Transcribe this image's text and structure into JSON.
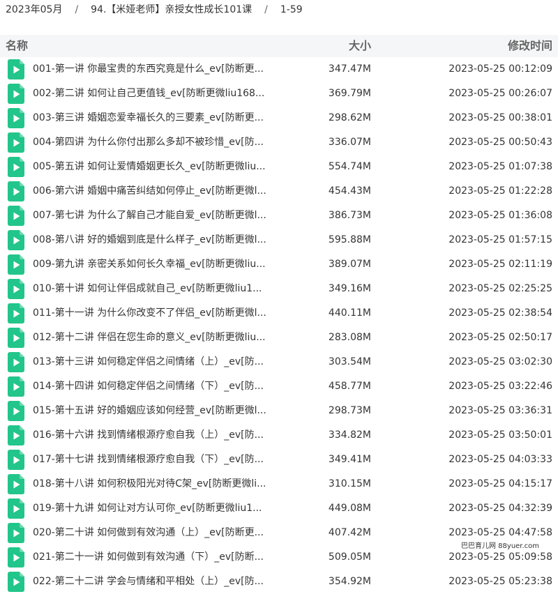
{
  "breadcrumb": {
    "items": [
      "2023年05月",
      "94.【米娅老师】亲授女性成长101课",
      "1-59"
    ],
    "separator": "/"
  },
  "list_header": {
    "name": "名称",
    "size": "大小",
    "modified": "修改时间"
  },
  "colors": {
    "file_icon_green": "#22c58a",
    "header_bg": "#f5f6f7"
  },
  "files": [
    {
      "name": "001-第一讲 你最宝贵的东西究竟是什么_ev[防断更...",
      "size": "347.47M",
      "modified": "2023-05-25 00:12:09",
      "icon": "video-file-icon"
    },
    {
      "name": "002-第二讲 如何让自己更值钱_ev[防断更微liu168...",
      "size": "369.79M",
      "modified": "2023-05-25 00:26:07",
      "icon": "video-file-icon"
    },
    {
      "name": "003-第三讲 婚姻恋爱幸福长久的三要素_ev[防断更...",
      "size": "298.62M",
      "modified": "2023-05-25 00:38:01",
      "icon": "video-file-icon"
    },
    {
      "name": "004-第四讲 为什么你付出那么多却不被珍惜_ev[防...",
      "size": "336.07M",
      "modified": "2023-05-25 00:50:43",
      "icon": "video-file-icon"
    },
    {
      "name": "005-第五讲 如何让爱情婚姻更长久_ev[防断更微liu...",
      "size": "554.74M",
      "modified": "2023-05-25 01:07:38",
      "icon": "video-file-icon"
    },
    {
      "name": "006-第六讲 婚姻中痛苦纠结如何停止_ev[防断更微l...",
      "size": "454.43M",
      "modified": "2023-05-25 01:22:28",
      "icon": "video-file-icon"
    },
    {
      "name": "007-第七讲 为什么了解自己才能自爱_ev[防断更微l...",
      "size": "386.73M",
      "modified": "2023-05-25 01:36:08",
      "icon": "video-file-icon"
    },
    {
      "name": "008-第八讲 好的婚姻到底是什么样子_ev[防断更微l...",
      "size": "595.88M",
      "modified": "2023-05-25 01:57:15",
      "icon": "video-file-icon"
    },
    {
      "name": "009-第九讲 亲密关系如何长久幸福_ev[防断更微liu...",
      "size": "389.07M",
      "modified": "2023-05-25 02:11:19",
      "icon": "video-file-icon"
    },
    {
      "name": "010-第十讲 如何让伴侣成就自己_ev[防断更微liu1...",
      "size": "349.16M",
      "modified": "2023-05-25 02:25:25",
      "icon": "video-file-icon"
    },
    {
      "name": "011-第十一讲 为什么你改变不了伴侣_ev[防断更微l...",
      "size": "440.11M",
      "modified": "2023-05-25 02:38:54",
      "icon": "video-file-icon"
    },
    {
      "name": "012-第十二讲 伴侣在您生命的意义_ev[防断更微liu...",
      "size": "283.08M",
      "modified": "2023-05-25 02:50:17",
      "icon": "video-file-icon"
    },
    {
      "name": "013-第十三讲 如何稳定伴侣之间情绪（上）_ev[防...",
      "size": "303.54M",
      "modified": "2023-05-25 03:02:30",
      "icon": "video-file-icon"
    },
    {
      "name": "014-第十四讲 如何稳定伴侣之间情绪（下）_ev[防...",
      "size": "458.77M",
      "modified": "2023-05-25 03:22:46",
      "icon": "video-file-icon"
    },
    {
      "name": "015-第十五讲 好的婚姻应该如何经营_ev[防断更微l...",
      "size": "298.73M",
      "modified": "2023-05-25 03:36:31",
      "icon": "video-file-icon"
    },
    {
      "name": "016-第十六讲 找到情绪根源疗愈自我（上）_ev[防...",
      "size": "334.82M",
      "modified": "2023-05-25 03:50:01",
      "icon": "video-file-icon"
    },
    {
      "name": "017-第十七讲 找到情绪根源疗愈自我（下）_ev[防...",
      "size": "349.41M",
      "modified": "2023-05-25 04:03:33",
      "icon": "video-file-icon"
    },
    {
      "name": "018-第十八讲 如何积极阳光对待C架_ev[防断更微li...",
      "size": "310.15M",
      "modified": "2023-05-25 04:15:17",
      "icon": "video-file-icon"
    },
    {
      "name": "019-第十九讲 如何让对方认可你_ev[防断更微liu1...",
      "size": "449.08M",
      "modified": "2023-05-25 04:32:39",
      "icon": "video-file-icon"
    },
    {
      "name": "020-第二十讲 如何做到有效沟通（上）_ev[防断更...",
      "size": "407.42M",
      "modified": "2023-05-25 04:47:58",
      "icon": "video-file-icon"
    },
    {
      "name": "021-第二十一讲 如何做到有效沟通（下）_ev[防断...",
      "size": "509.05M",
      "modified": "2023-05-25 05:09:58",
      "icon": "video-file-icon"
    },
    {
      "name": "022-第二十二讲 学会与情绪和平相处（上）_ev[防...",
      "size": "354.92M",
      "modified": "2023-05-25 05:23:38",
      "icon": "video-file-icon"
    }
  ],
  "watermark": "巴巴育儿网 88yuer.com"
}
